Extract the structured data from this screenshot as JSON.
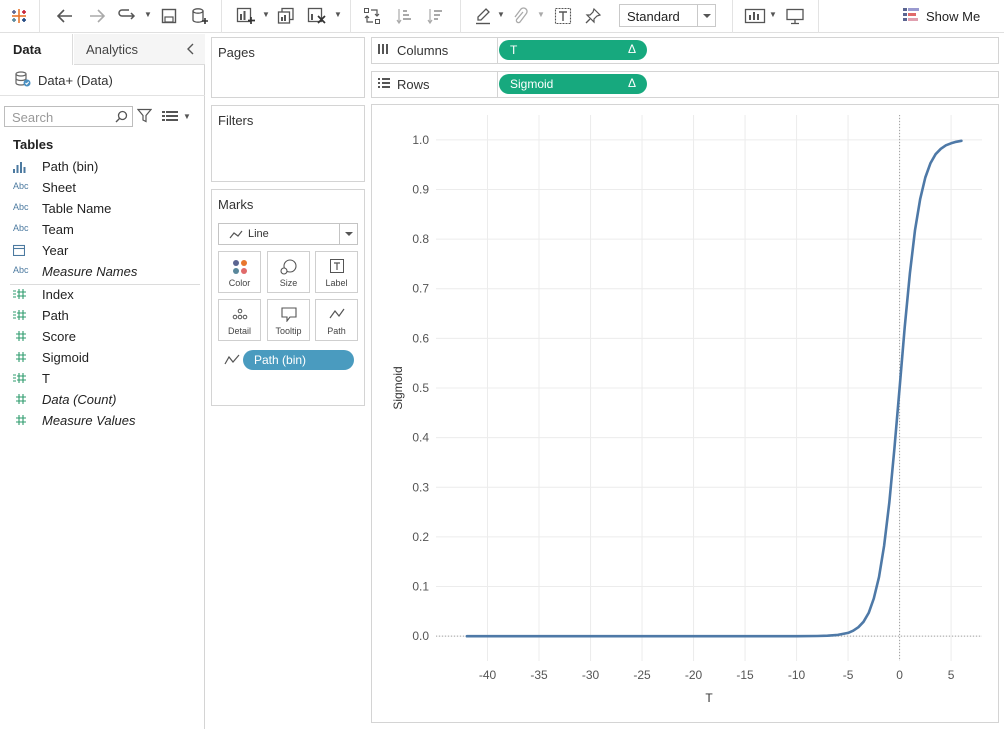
{
  "toolbar": {
    "mark_size_select": "Standard",
    "show_me_label": "Show Me",
    "icons": [
      "tableau-logo-icon",
      "back-icon",
      "forward-icon",
      "redo-icon",
      "save-icon",
      "new-datasource-icon",
      "new-worksheet-icon",
      "duplicate-icon",
      "clear-icon",
      "swap-icon",
      "sort-asc-icon",
      "sort-desc-icon",
      "highlight-icon",
      "attach-icon",
      "text-icon",
      "pin-icon",
      "chart-icon",
      "presentation-icon",
      "show-me-icon"
    ]
  },
  "side": {
    "tab_data": "Data",
    "tab_analytics": "Analytics",
    "datasource": "Data+ (Data)",
    "search_placeholder": "Search",
    "tables_heading": "Tables",
    "dimensions": [
      {
        "type": "bin",
        "label": "Path (bin)"
      },
      {
        "type": "Abc",
        "label": "Sheet"
      },
      {
        "type": "Abc",
        "label": "Table Name"
      },
      {
        "type": "Abc",
        "label": "Team"
      },
      {
        "type": "date",
        "label": "Year"
      },
      {
        "type": "Abc",
        "label": "Measure Names",
        "italic": true
      }
    ],
    "measures": [
      {
        "type": "measure",
        "label": "Index"
      },
      {
        "type": "measure",
        "label": "Path"
      },
      {
        "type": "measure",
        "label": "Score"
      },
      {
        "type": "measure",
        "label": "Sigmoid"
      },
      {
        "type": "measure",
        "label": "T"
      },
      {
        "type": "measure",
        "label": "Data (Count)",
        "italic": true
      },
      {
        "type": "measure",
        "label": "Measure Values",
        "italic": true
      }
    ]
  },
  "cards": {
    "pages": "Pages",
    "filters": "Filters",
    "marks": "Marks",
    "mark_type": "Line",
    "buttons": [
      "Color",
      "Size",
      "Label",
      "Detail",
      "Tooltip",
      "Path"
    ],
    "path_pill": "Path (bin)"
  },
  "shelves": {
    "columns_label": "Columns",
    "columns_pill": "T",
    "rows_label": "Rows",
    "rows_pill": "Sigmoid",
    "delta": "Δ"
  },
  "colors": {
    "pill_green": "#17a97e",
    "pill_blue": "#4a9bbf",
    "line": "#4e79a7"
  },
  "chart_data": {
    "type": "line",
    "title": "",
    "xlabel": "T",
    "ylabel": "Sigmoid",
    "xlim": [
      -45,
      8
    ],
    "ylim": [
      -0.05,
      1.05
    ],
    "x_ticks": [
      -40,
      -35,
      -30,
      -25,
      -20,
      -15,
      -10,
      -5,
      0,
      5
    ],
    "y_ticks": [
      0.0,
      0.1,
      0.2,
      0.3,
      0.4,
      0.5,
      0.6,
      0.7,
      0.8,
      0.9,
      1.0
    ],
    "y_tick_labels": [
      "0.0",
      "0.1",
      "0.2",
      "0.3",
      "0.4",
      "0.5",
      "0.6",
      "0.7",
      "0.8",
      "0.9",
      "1.0"
    ],
    "grid": true,
    "zero_reference_lines": true,
    "series": [
      {
        "x": [
          -42,
          -35,
          -30,
          -25,
          -20,
          -15,
          -10,
          -8,
          -7,
          -6,
          -5,
          -4.5,
          -4,
          -3.5,
          -3,
          -2.5,
          -2,
          -1.5,
          -1,
          -0.5,
          0,
          0.5,
          1,
          1.5,
          2,
          2.5,
          3,
          3.5,
          4,
          4.5,
          5,
          5.5,
          6
        ],
        "y": [
          0,
          0,
          0,
          0,
          0,
          0,
          5e-05,
          0.0003,
          0.0009,
          0.0025,
          0.0067,
          0.011,
          0.018,
          0.029,
          0.047,
          0.076,
          0.119,
          0.182,
          0.269,
          0.378,
          0.5,
          0.622,
          0.731,
          0.818,
          0.881,
          0.924,
          0.953,
          0.971,
          0.982,
          0.989,
          0.993,
          0.996,
          0.998
        ]
      }
    ]
  }
}
